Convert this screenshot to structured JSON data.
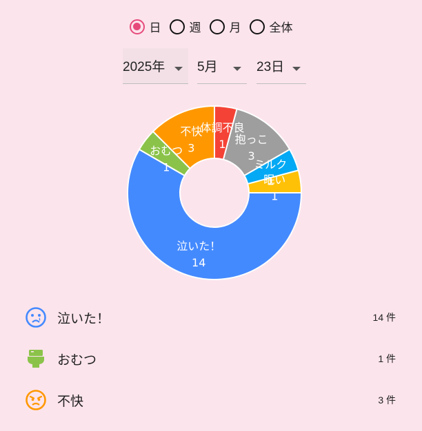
{
  "period": {
    "options": [
      {
        "label": "日",
        "checked": true
      },
      {
        "label": "週",
        "checked": false
      },
      {
        "label": "月",
        "checked": false
      },
      {
        "label": "全体",
        "checked": false
      }
    ]
  },
  "date": {
    "year": "2025年",
    "month": "5月",
    "day": "23日"
  },
  "chart_data": {
    "type": "pie",
    "donut": true,
    "slices": [
      {
        "label": "体調不良",
        "value": 1,
        "color": "#f44336"
      },
      {
        "label": "抱っこ",
        "value": 3,
        "color": "#9e9e9e"
      },
      {
        "label": "ミルク",
        "value": 1,
        "color": "#03a9f4"
      },
      {
        "label": "眠い",
        "value": 1,
        "color": "#ffc107"
      },
      {
        "label": "泣いた！",
        "value": 14,
        "color": "#448aff"
      },
      {
        "label": "おむつ",
        "value": 1,
        "color": "#8bc34a"
      },
      {
        "label": "不快",
        "value": 3,
        "color": "#ff9800"
      }
    ]
  },
  "list": [
    {
      "label": "泣いた！",
      "count": "14 件",
      "icon": "crying-face-icon",
      "color": "#448aff"
    },
    {
      "label": "おむつ",
      "count": "1 件",
      "icon": "toilet-icon",
      "color": "#8bc34a"
    },
    {
      "label": "不快",
      "count": "3 件",
      "icon": "angry-face-icon",
      "color": "#ff9800"
    }
  ],
  "colors": {
    "background": "#fce4ec",
    "accent": "#e64a7b"
  }
}
